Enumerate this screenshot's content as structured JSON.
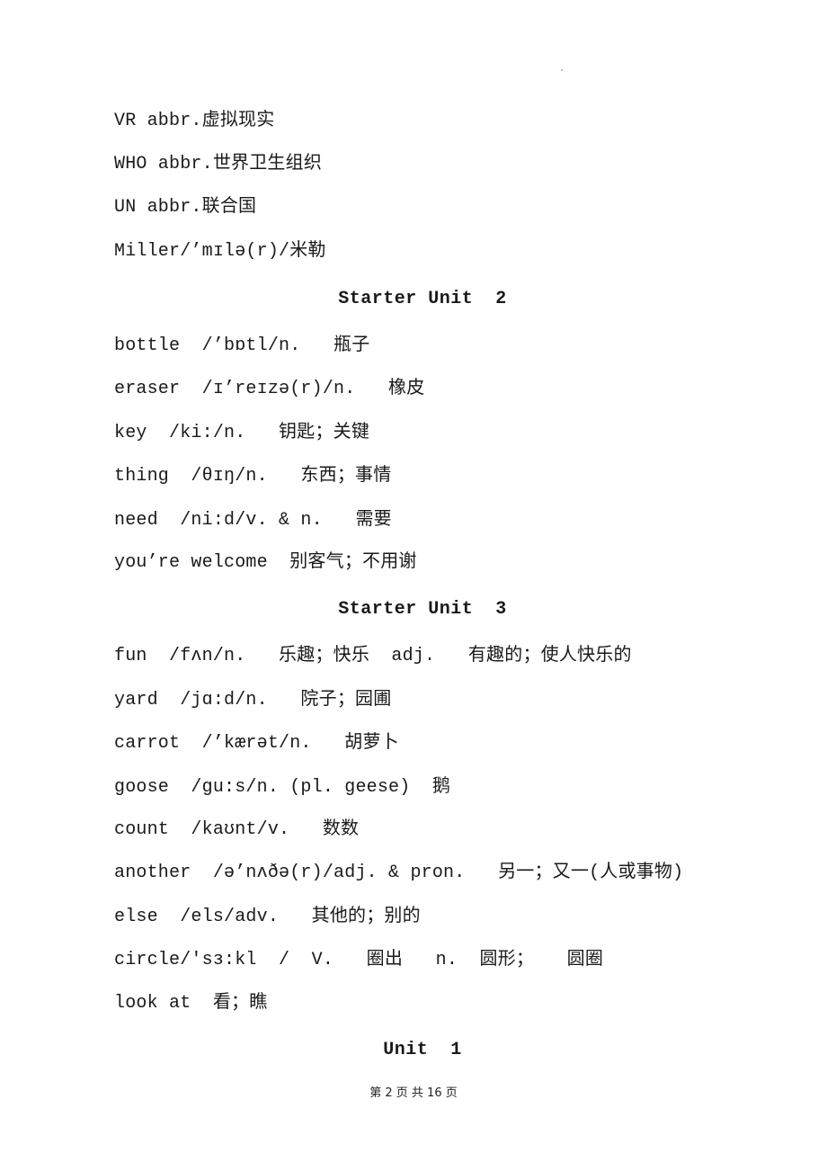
{
  "entries_top": [
    "VR abbr.虚拟现实",
    "WHO abbr.世界卫生组织",
    "UN abbr.联合国",
    "Miller/’mɪlə(r)/米勒"
  ],
  "sections": [
    {
      "title": "Starter Unit  2",
      "entries": [
        "bottle  /’bɒtl/n.   瓶子",
        "eraser  /ɪ’reɪzə(r)/n.   橡皮",
        "key  /ki:/n.   钥匙；关键",
        "thing  /θɪŋ/n.   东西；事情",
        "need  /ni:d/v. & n.   需要",
        "you’re welcome  别客气；不用谢"
      ]
    },
    {
      "title": "Starter Unit  3",
      "entries": [
        "fun  /fʌn/n.   乐趣；快乐  adj.   有趣的；使人快乐的",
        "yard  /jɑ:d/n.   院子；园圃",
        "carrot  /’kærət/n.   胡萝卜",
        "goose  /gu:s/n. (pl. geese)  鹅",
        "count  /kaʊnt/v.   数数",
        "another  /ə’nʌðə(r)/adj. & pron.   另一；又一(人或事物)",
        "else  /els/adv.   其他的；别的",
        "circle/'sɜ:kl  /  V.   圈出   n.  圆形；   圆圈",
        "look at  看；瞧"
      ]
    },
    {
      "title": "Unit  1",
      "entries": []
    }
  ],
  "footer": "第 2 页 共 16 页"
}
